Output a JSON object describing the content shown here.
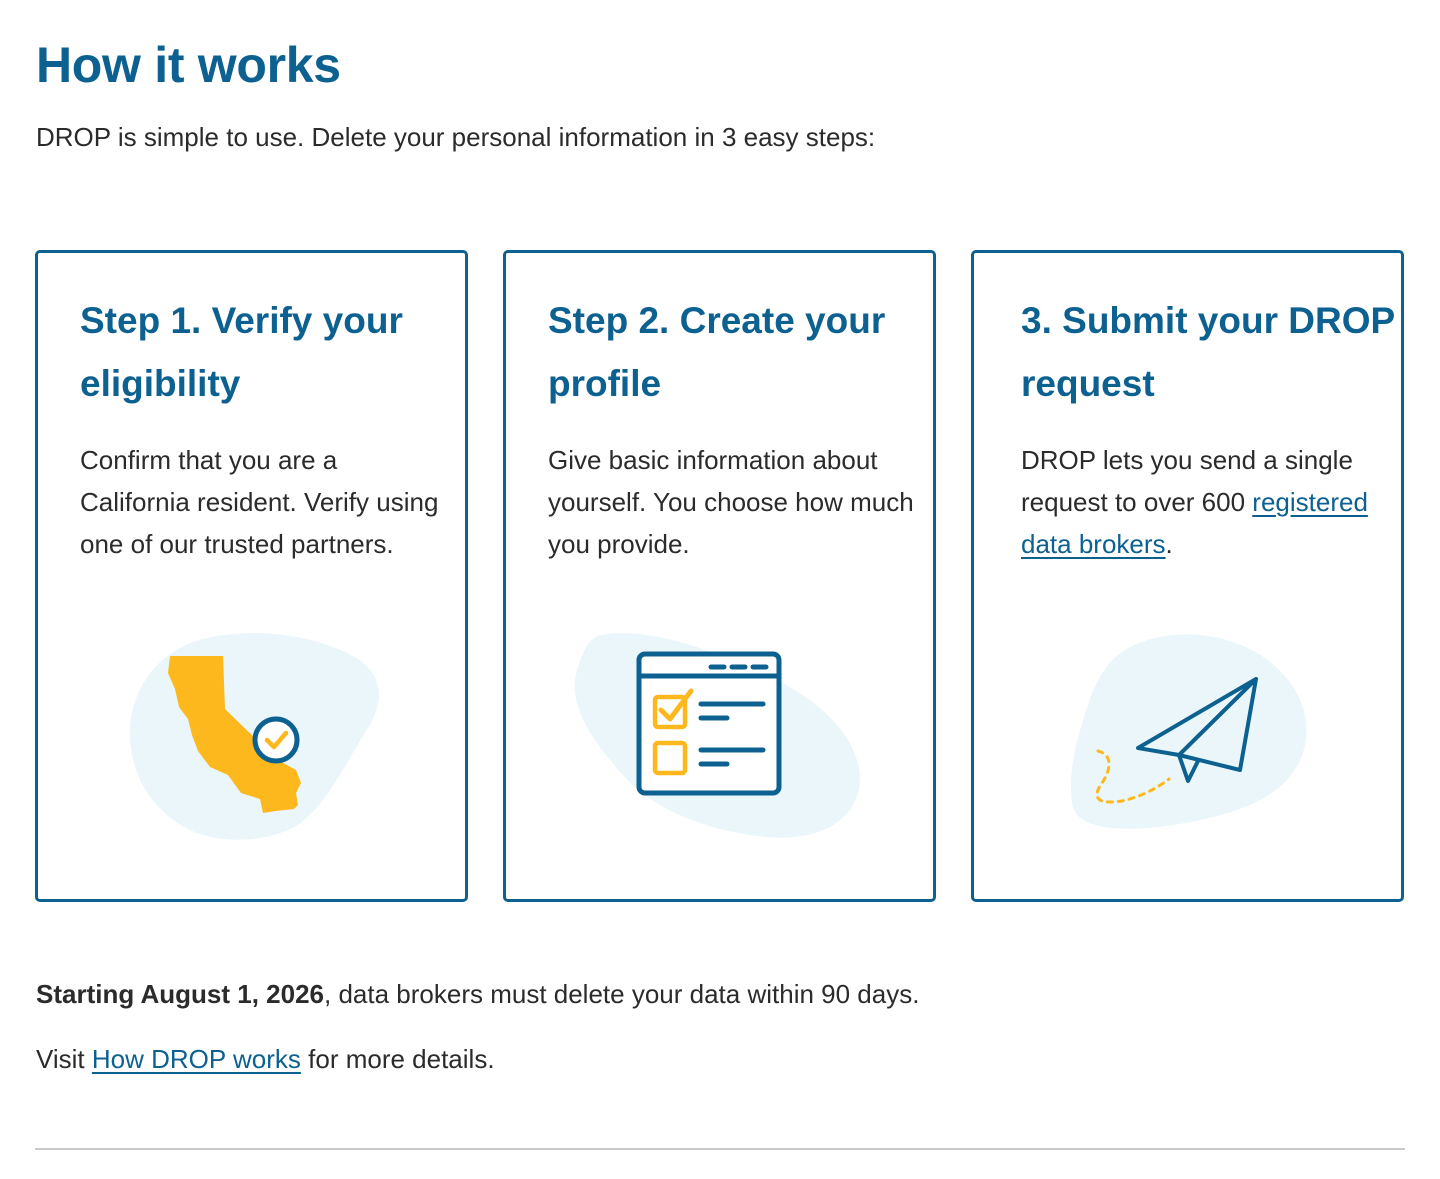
{
  "header": {
    "title": "How it works",
    "intro": "DROP is simple to use. Delete your personal information in 3 easy steps:"
  },
  "steps": [
    {
      "title": "Step 1. Verify your eligibility",
      "body": "Confirm that you are a California resident. Verify using one of our trusted partners.",
      "icon": "california-map-check-icon"
    },
    {
      "title": "Step 2. Create your profile",
      "body": "Give basic information about yourself. You choose how much you provide.",
      "icon": "profile-checklist-icon"
    },
    {
      "title": "3. Submit your DROP request",
      "body_before": "DROP lets you send a single request to over 600",
      "link": "registered data brokers",
      "body_after": ".",
      "icon": "paper-plane-icon"
    }
  ],
  "footer": {
    "deadline_bold": "Starting August 1, 2026",
    "deadline_rest": ", data brokers must delete your data within 90 days.",
    "visit_before": "Visit",
    "visit_link": "How DROP works",
    "visit_after": "for more details."
  },
  "colors": {
    "brand_blue": "#0d6191",
    "accent_gold": "#fdb81e",
    "blob_bg": "#eaf6fa",
    "text": "#2b2b2b",
    "divider": "#c9c9c9"
  }
}
